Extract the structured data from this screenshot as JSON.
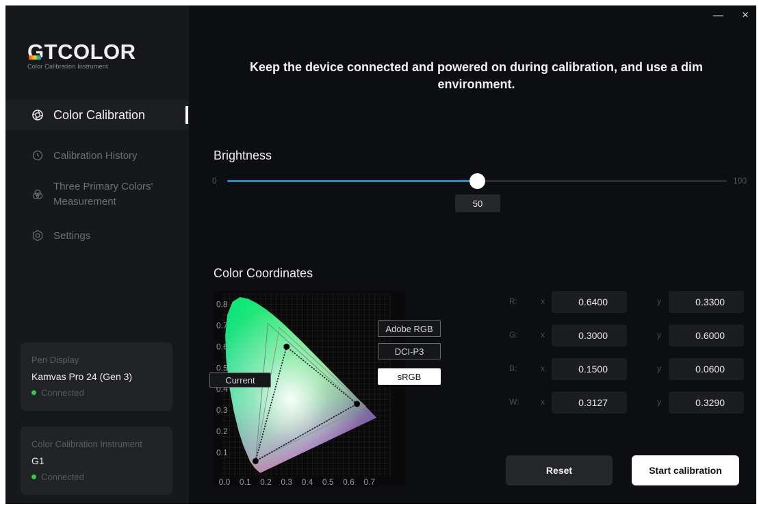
{
  "window": {
    "minimize_glyph": "—",
    "close_glyph": "×"
  },
  "logo": {
    "brand_prefix": "GT",
    "brand_main": "COLOR",
    "subtitle": "Color Calibration Instrument"
  },
  "sidebar": {
    "items": [
      {
        "label": "Color Calibration",
        "icon": "aperture-icon",
        "active": true
      },
      {
        "label": "Calibration History",
        "icon": "clock-icon",
        "active": false
      },
      {
        "label_line1": "Three Primary Colors'",
        "label_line2": "Measurement",
        "icon": "rgb-circles-icon",
        "active": false
      },
      {
        "label": "Settings",
        "icon": "gear-icon",
        "active": false
      }
    ],
    "device_card": {
      "label": "Pen Display",
      "name": "Kamvas Pro 24 (Gen 3)",
      "status": "Connected"
    },
    "instrument_card": {
      "label": "Color Calibration Instrument",
      "name": "G1",
      "status": "Connected"
    }
  },
  "main": {
    "instruction": "Keep the device connected and powered on during calibration, and use a dim environment.",
    "brightness": {
      "title": "Brightness",
      "min_label": "0",
      "max_label": "100",
      "value": 50,
      "value_label": "50"
    },
    "coordinates": {
      "title": "Color Coordinates",
      "rows": [
        {
          "label": "R:",
          "x": "0.6400",
          "y": "0.3300"
        },
        {
          "label": "G:",
          "x": "0.3000",
          "y": "0.6000"
        },
        {
          "label": "B:",
          "x": "0.1500",
          "y": "0.0600"
        },
        {
          "label": "W:",
          "x": "0.3127",
          "y": "0.3290"
        }
      ],
      "x_axis_label": "x",
      "y_axis_label": "y"
    },
    "buttons": {
      "reset": "Reset",
      "start": "Start calibration"
    }
  },
  "chart_data": {
    "type": "scatter",
    "x_ticks": [
      "0.0",
      "0.1",
      "0.2",
      "0.3",
      "0.4",
      "0.5",
      "0.6",
      "0.7"
    ],
    "y_ticks": [
      "0.1",
      "0.2",
      "0.3",
      "0.4",
      "0.5",
      "0.6",
      "0.7",
      "0.8"
    ],
    "xlim": [
      0,
      0.8
    ],
    "ylim": [
      0,
      0.85
    ],
    "grid": true,
    "legend": [
      "Adobe RGB",
      "DCI-P3",
      "sRGB",
      "Current"
    ],
    "selected_legend": "sRGB",
    "gamuts": [
      {
        "name": "Adobe RGB",
        "points": [
          [
            0.64,
            0.33
          ],
          [
            0.21,
            0.71
          ],
          [
            0.15,
            0.06
          ]
        ]
      },
      {
        "name": "DCI-P3",
        "points": [
          [
            0.68,
            0.32
          ],
          [
            0.265,
            0.69
          ],
          [
            0.15,
            0.06
          ]
        ]
      },
      {
        "name": "sRGB",
        "points": [
          [
            0.64,
            0.33
          ],
          [
            0.3,
            0.6
          ],
          [
            0.15,
            0.06
          ]
        ]
      },
      {
        "name": "Current",
        "points": [
          [
            0.64,
            0.33
          ],
          [
            0.3,
            0.6
          ],
          [
            0.15,
            0.06
          ]
        ]
      }
    ]
  }
}
